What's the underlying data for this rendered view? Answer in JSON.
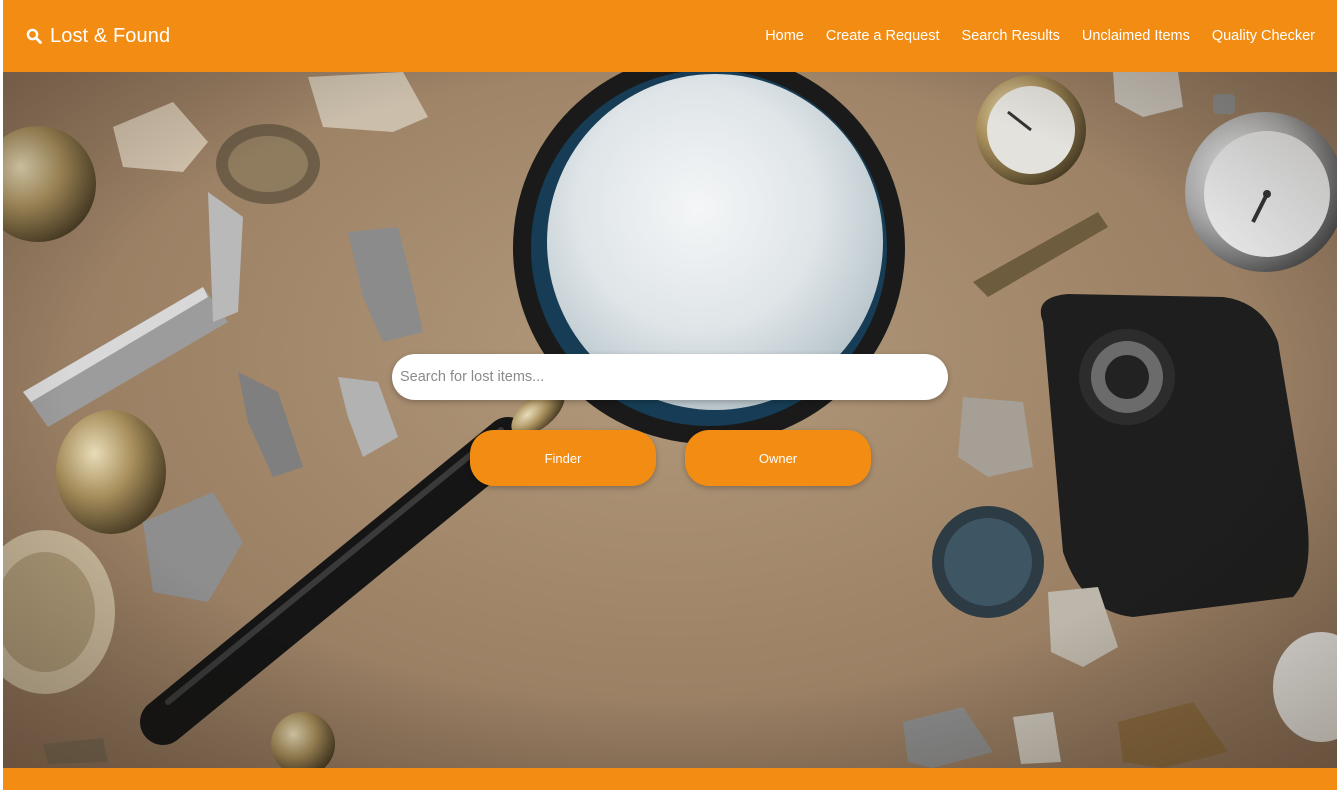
{
  "navbar": {
    "brand_icon": "search-icon",
    "brand_label": "Lost & Found",
    "links": [
      {
        "label": "Home"
      },
      {
        "label": "Create a Request"
      },
      {
        "label": "Search Results"
      },
      {
        "label": "Unclaimed Items"
      },
      {
        "label": "Quality Checker"
      }
    ]
  },
  "hero": {
    "search": {
      "placeholder": "Search for lost items...",
      "value": ""
    },
    "finder_label": "Finder",
    "owner_label": "Owner"
  },
  "colors": {
    "accent": "#f28c13",
    "background_kraft": "#a18669",
    "text_on_accent": "#ffffff"
  }
}
